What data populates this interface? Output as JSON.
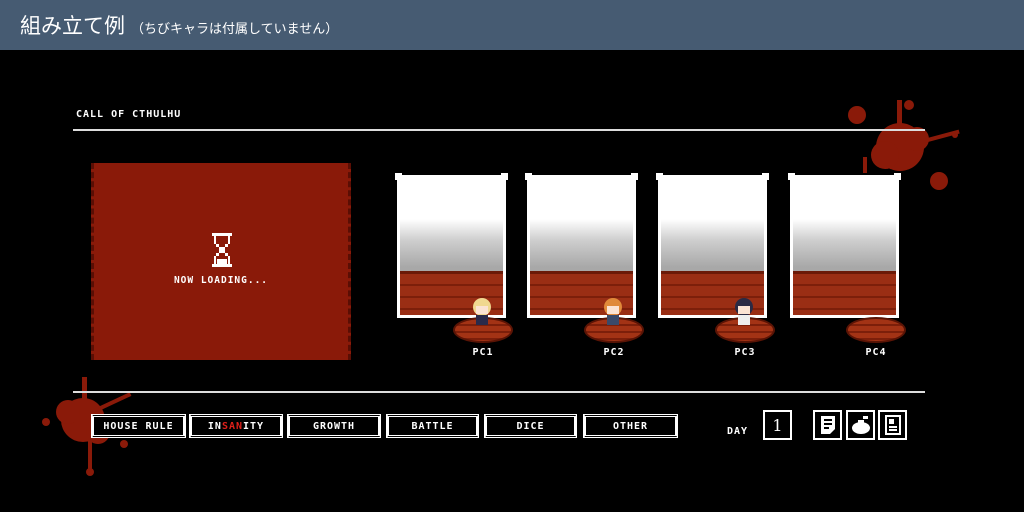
{
  "header": {
    "title": "組み立て例",
    "subtitle": "（ちびキャラは付属していません）"
  },
  "game": {
    "title": "CALL OF CTHULHU",
    "loading_text": "NOW LOADING..."
  },
  "characters": [
    {
      "label": "PC1"
    },
    {
      "label": "PC2"
    },
    {
      "label": "PC3"
    },
    {
      "label": "PC4"
    }
  ],
  "tabs": [
    {
      "label": "HOUSE RULE"
    },
    {
      "label_pre": "IN",
      "label_highlight": "SAN",
      "label_post": "ITY"
    },
    {
      "label": "GROWTH"
    },
    {
      "label": "BATTLE"
    },
    {
      "label": "DICE"
    },
    {
      "label": "OTHER"
    }
  ],
  "day": {
    "label": "DAY",
    "value": "1"
  },
  "icons": [
    "memo-icon",
    "bag-icon",
    "sheet-icon"
  ],
  "colors": {
    "header": "#465b72",
    "blood": "#8a1a09",
    "highlight": "#e0201a"
  }
}
